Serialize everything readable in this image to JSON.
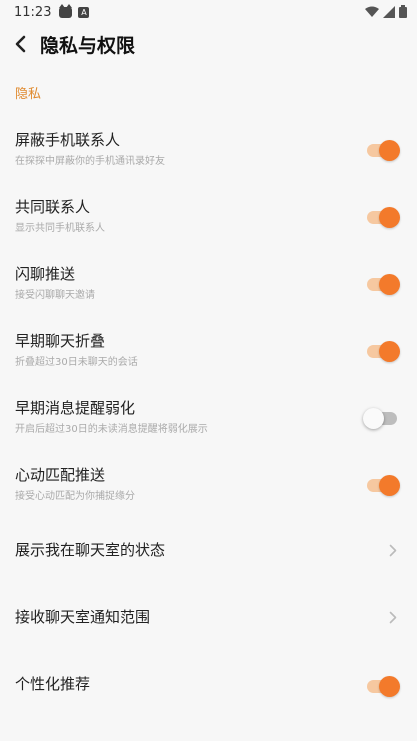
{
  "status_bar": {
    "time": "11:23",
    "a_icon_letter": "A"
  },
  "header": {
    "title": "隐私与权限"
  },
  "section": {
    "label": "隐私"
  },
  "items": [
    {
      "title": "屏蔽手机联系人",
      "subtitle": "在探探中屏蔽你的手机通讯录好友",
      "control": "toggle",
      "on": true
    },
    {
      "title": "共同联系人",
      "subtitle": "显示共同手机联系人",
      "control": "toggle",
      "on": true
    },
    {
      "title": "闪聊推送",
      "subtitle": "接受闪聊聊天邀请",
      "control": "toggle",
      "on": true
    },
    {
      "title": "早期聊天折叠",
      "subtitle": "折叠超过30日未聊天的会话",
      "control": "toggle",
      "on": true
    },
    {
      "title": "早期消息提醒弱化",
      "subtitle": "开启后超过30日的未读消息提醒将弱化展示",
      "control": "toggle",
      "on": false
    },
    {
      "title": "心动匹配推送",
      "subtitle": "接受心动匹配为你捕捉缘分",
      "control": "toggle",
      "on": true
    },
    {
      "title": "展示我在聊天室的状态",
      "subtitle": "",
      "control": "chevron"
    },
    {
      "title": "接收聊天室通知范围",
      "subtitle": "",
      "control": "chevron"
    },
    {
      "title": "个性化推荐",
      "subtitle": "",
      "control": "toggle",
      "on": true
    }
  ],
  "colors": {
    "accent": "#f37a2b",
    "section_label": "#e08a2e"
  }
}
